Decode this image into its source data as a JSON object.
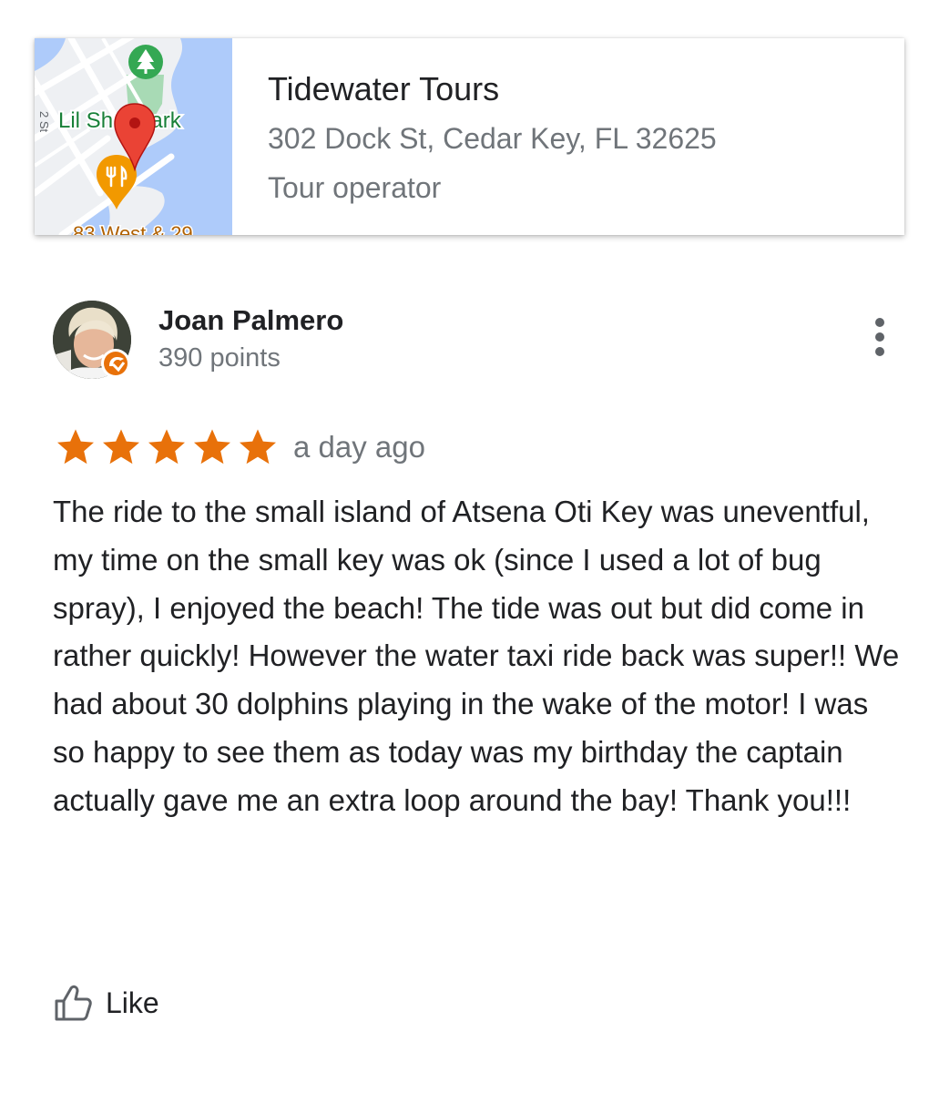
{
  "place": {
    "name": "Tidewater Tours",
    "address": "302 Dock St, Cedar Key, FL 32625",
    "category": "Tour operator",
    "map": {
      "park_label": "Lil Sh   k Park",
      "bottom_label": "83 West & 29",
      "street_label": "2 St",
      "icons": [
        "park-icon",
        "restaurant-icon",
        "location-pin-icon"
      ],
      "colors": {
        "water": "#aecbfa",
        "land": "#eef0f3",
        "road": "#ffffff",
        "park": "#a8dab5",
        "pin": "#ea4335",
        "restaurant": "#f29900"
      }
    }
  },
  "review": {
    "author": "Joan Palmero",
    "points": "390 points",
    "badge": "local-guide-icon",
    "more_icon": "more-vert-icon",
    "rating": 5,
    "max_rating": 5,
    "star_color": "#e8710a",
    "date": "a day ago",
    "text": "The ride to the small island of Atsena Oti Key was uneventful, my time on the small key was ok (since I used a lot of bug spray), I enjoyed the beach! The tide was out but did come in rather quickly! However the water taxi ride back was super!! We had about 30 dolphins playing in the wake of the motor! I was so happy to see them as today was my birthday the captain actually gave me an extra loop around the bay! Thank you!!!",
    "like_label": "Like",
    "like_icon": "thumbs-up-icon"
  }
}
